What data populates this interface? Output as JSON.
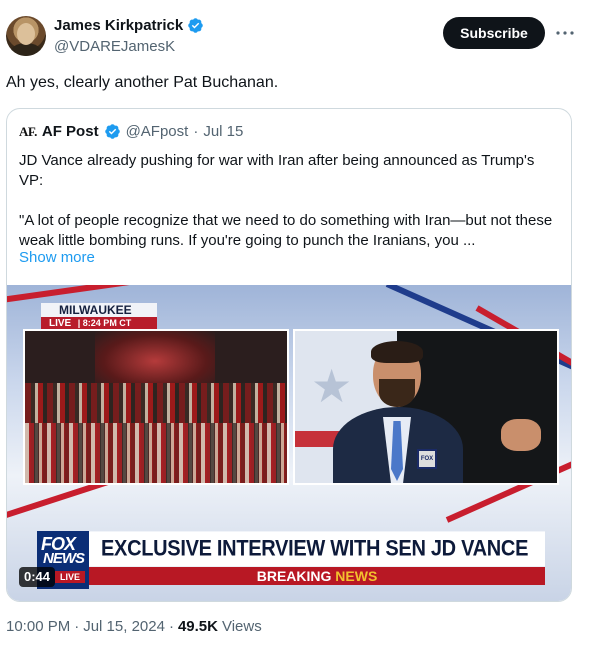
{
  "author": {
    "display_name": "James Kirkpatrick",
    "handle": "@VDAREJamesK",
    "verified_color": "#1d9bf0",
    "avatar_icon": "portrait-avatar"
  },
  "header": {
    "subscribe_label": "Subscribe",
    "more_icon": "more-horizontal-icon"
  },
  "tweet": {
    "text": "Ah yes, clearly another Pat Buchanan."
  },
  "quote": {
    "logo_text": "AF.",
    "name": "AF Post",
    "handle": "@AFpost",
    "separator": "·",
    "date": "Jul 15",
    "paragraph1": "JD Vance already pushing for war with Iran after being announced as Trump's VP:",
    "paragraph2": "\"A lot of people recognize that we need to do something with Iran—but not these weak little bombing runs.  If you're going to punch the Iranians, you ...",
    "show_more": "Show more",
    "video": {
      "location": "MILWAUKEE",
      "live_label": "LIVE",
      "live_divider": "|",
      "time": "8:24 PM CT",
      "headline": "EXCLUSIVE INTERVIEW WITH SEN JD VANCE",
      "breaking_part1": "BREAKING",
      "breaking_part2": "NEWS",
      "network_line1": "FOX",
      "network_line2": "NEWS",
      "network_live": "LIVE",
      "mic_flag": "FOX",
      "duration": "0:44"
    }
  },
  "footer": {
    "time": "10:00 PM",
    "separator1": "·",
    "date": "Jul 15, 2024",
    "separator2": "·",
    "views_count": "49.5K",
    "views_label": "Views"
  }
}
